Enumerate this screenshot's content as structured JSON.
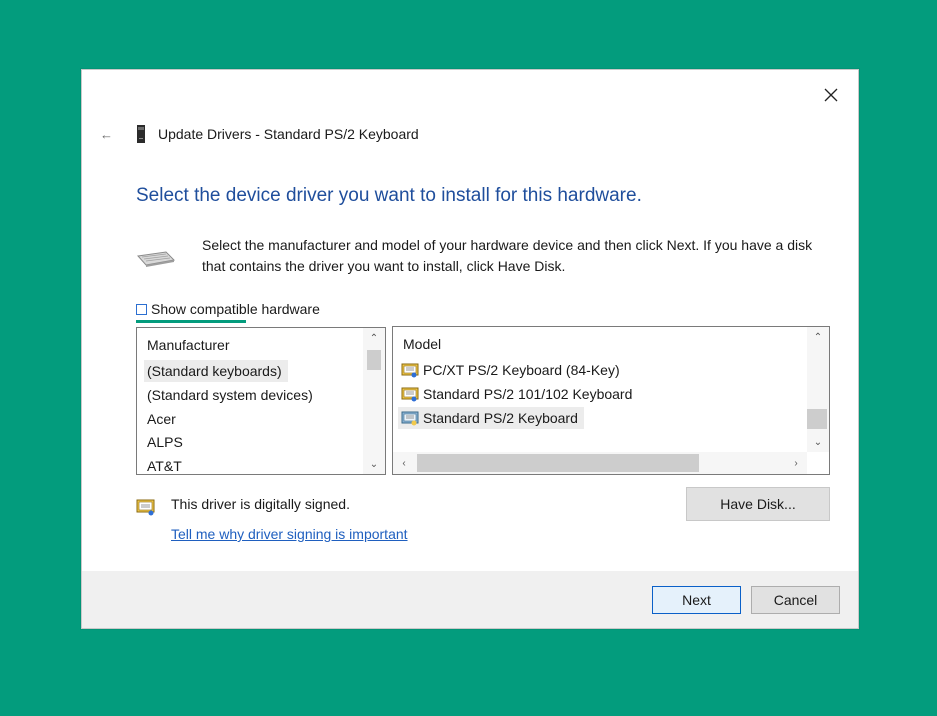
{
  "window": {
    "title": "Update Drivers - Standard PS/2 Keyboard",
    "close_icon": "close-icon",
    "back_icon": "back-arrow-icon"
  },
  "heading": "Select the device driver you want to install for this hardware.",
  "description": "Select the manufacturer and model of your hardware device and then click Next. If you have a disk that contains the driver you want to install, click Have Disk.",
  "compatible": {
    "label": "Show compatible hardware",
    "checked": false
  },
  "manufacturer_list": {
    "header": "Manufacturer",
    "items": [
      "(Standard keyboards)",
      "(Standard system devices)",
      "Acer",
      "ALPS",
      "AT&T"
    ],
    "selected_index": 0
  },
  "model_list": {
    "header": "Model",
    "items": [
      "PC/XT PS/2 Keyboard (84-Key)",
      "Standard PS/2 101/102 Keyboard",
      "Standard PS/2 Keyboard"
    ],
    "selected_index": 2
  },
  "signing": {
    "status": "This driver is digitally signed.",
    "link": "Tell me why driver signing is important"
  },
  "buttons": {
    "have_disk": "Have Disk...",
    "next": "Next",
    "cancel": "Cancel"
  },
  "colors": {
    "background": "#039c7d",
    "heading": "#1f4e9c",
    "link": "#1f5fbf",
    "focus": "#039c7d"
  }
}
